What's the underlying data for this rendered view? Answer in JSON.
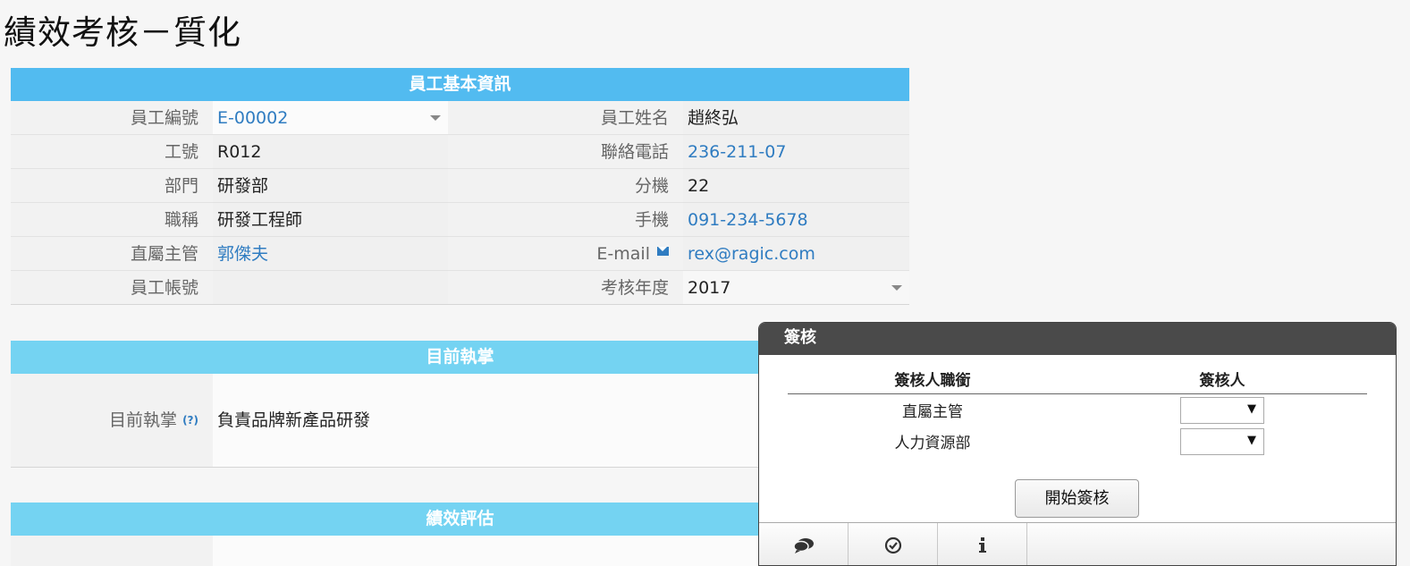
{
  "page": {
    "title": "績效考核－質化"
  },
  "basic": {
    "header": "員工基本資訊",
    "rows": [
      {
        "l1": "員工編號",
        "v1": "E-00002",
        "l2": "員工姓名",
        "v2": "趙終弘"
      },
      {
        "l1": "工號",
        "v1": "R012",
        "l2": "聯絡電話",
        "v2": "236-211-07"
      },
      {
        "l1": "部門",
        "v1": "研發部",
        "l2": "分機",
        "v2": "22"
      },
      {
        "l1": "職稱",
        "v1": "研發工程師",
        "l2": "手機",
        "v2": "091-234-5678"
      },
      {
        "l1": "直屬主管",
        "v1": "郭傑夫",
        "l2": "E-mail",
        "v2": "rex@ragic.com"
      },
      {
        "l1": "員工帳號",
        "v1": "",
        "l2": "考核年度",
        "v2": "2017"
      }
    ]
  },
  "current": {
    "header": "目前執掌",
    "label": "目前執掌",
    "help": "(?)",
    "value": "負責品牌新產品研發"
  },
  "eval": {
    "header": "績效評估"
  },
  "approval": {
    "title": "簽核",
    "col1": "簽核人職銜",
    "col2": "簽核人",
    "rows": [
      {
        "title": "直屬主管",
        "arrow": "▼"
      },
      {
        "title": "人力資源部",
        "arrow": "▼"
      }
    ],
    "start_button": "開始簽核",
    "tabs": [
      {
        "icon": "comment-icon",
        "glyph": "💬"
      },
      {
        "icon": "check-circle-icon",
        "glyph": "⊙"
      },
      {
        "icon": "info-icon",
        "glyph": "ℹ"
      }
    ]
  },
  "colors": {
    "header": "#52bbf0",
    "header_light": "#74d3f2",
    "link": "#2f7cc1",
    "panel_head": "#4a4a4a"
  }
}
